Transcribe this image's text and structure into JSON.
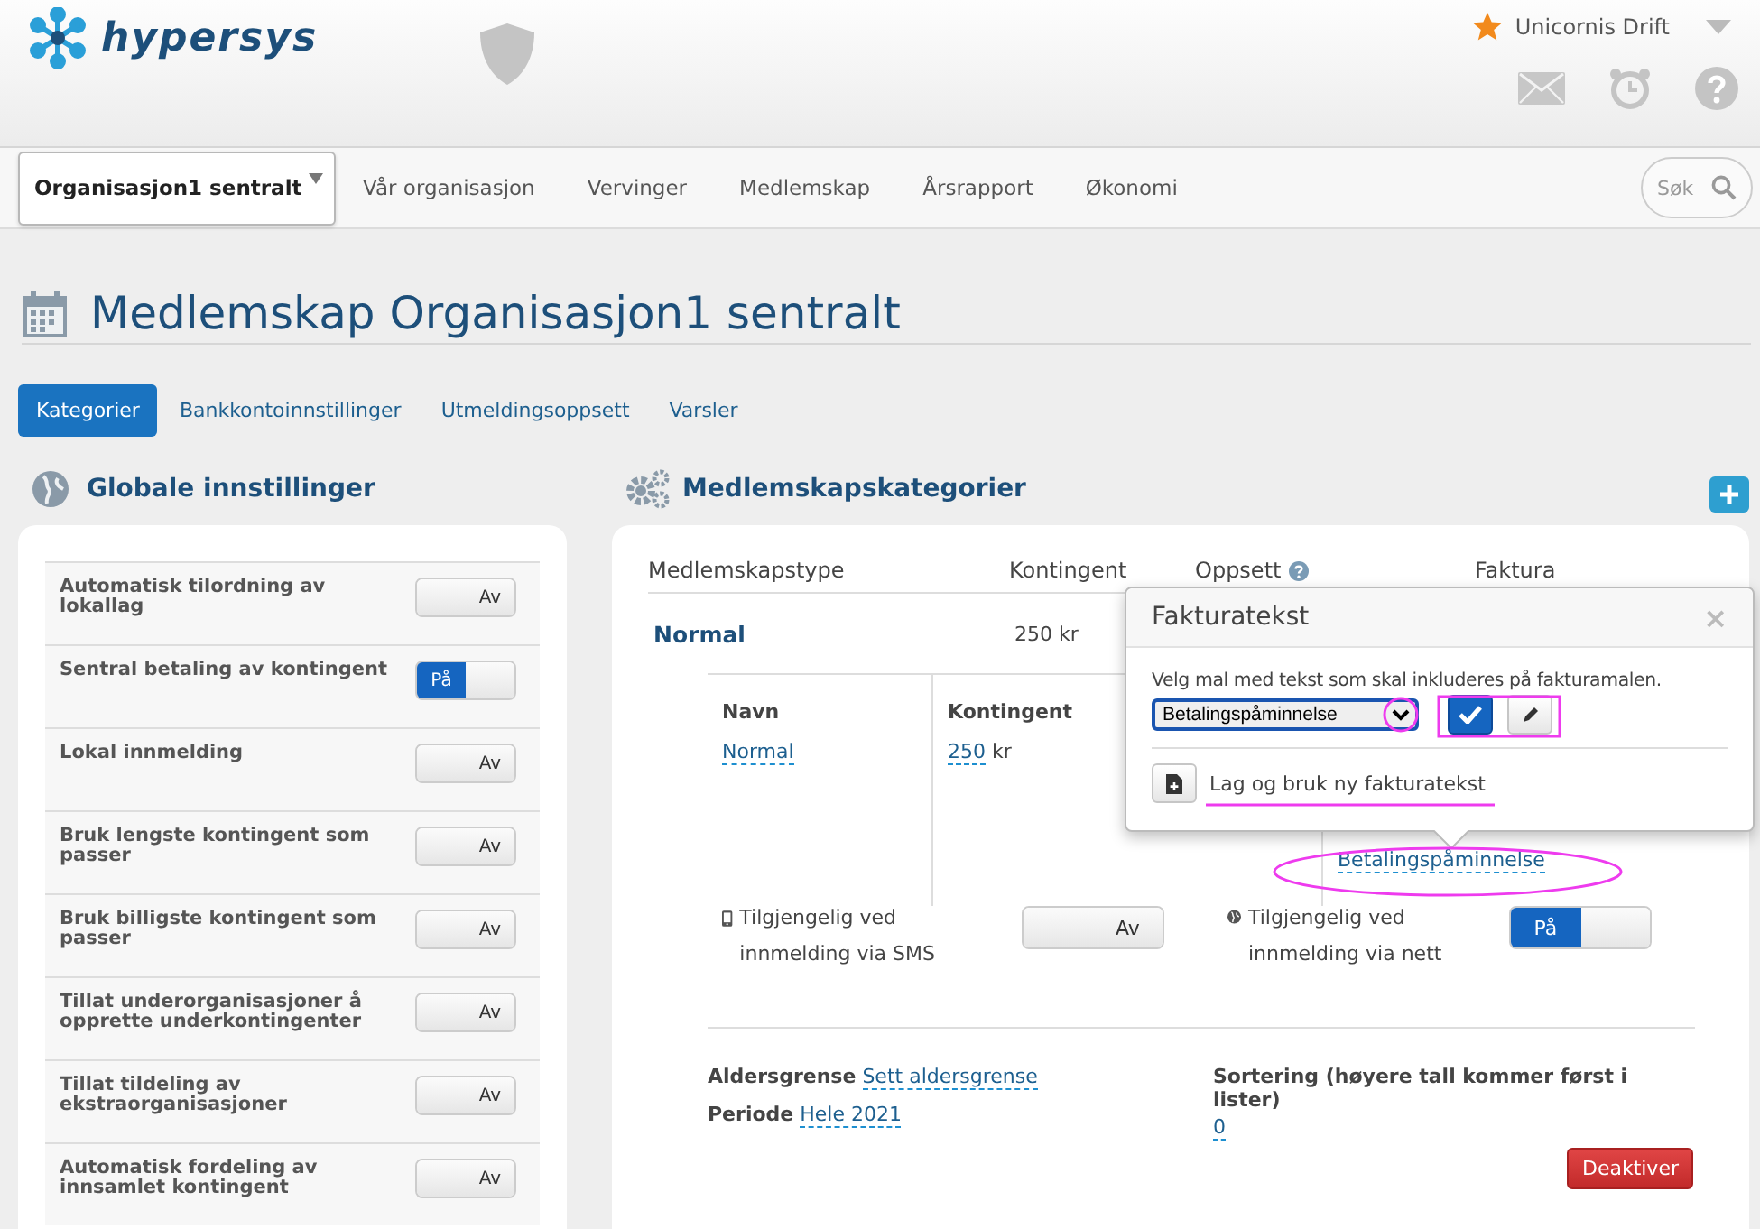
{
  "header": {
    "logo": "hypersys",
    "user": "Unicornis Drift"
  },
  "nav": {
    "org_select": "Organisasjon1 sentralt",
    "links": [
      "Vår organisasjon",
      "Vervinger",
      "Medlemskap",
      "Årsrapport",
      "Økonomi"
    ],
    "search": {
      "placeholder": "Søk"
    }
  },
  "page_title": "Medlemskap Organisasjon1 sentralt",
  "tabs": [
    {
      "label": "Kategorier",
      "selected": true
    },
    {
      "label": "Bankkontoinnstillinger",
      "selected": false
    },
    {
      "label": "Utmeldingsoppsett",
      "selected": false
    },
    {
      "label": "Varsler",
      "selected": false
    }
  ],
  "global_settings": {
    "title": "Globale innstillinger",
    "items": [
      {
        "label": "Automatisk tilordning av lokallag",
        "on": false,
        "toggle_text": "Av"
      },
      {
        "label": "Sentral betaling av kontingent",
        "on": true,
        "toggle_text": "På"
      },
      {
        "label": "Lokal innmelding",
        "on": false,
        "toggle_text": "Av"
      },
      {
        "label": "Bruk lengste kontingent som passer",
        "on": false,
        "toggle_text": "Av"
      },
      {
        "label": "Bruk billigste kontingent som passer",
        "on": false,
        "toggle_text": "Av"
      },
      {
        "label": "Tillat underorganisasjoner å opprette underkontingenter",
        "on": false,
        "toggle_text": "Av"
      },
      {
        "label": "Tillat tildeling av ekstraorganisasjoner",
        "on": false,
        "toggle_text": "Av"
      },
      {
        "label": "Automatisk fordeling av innsamlet kontingent",
        "on": false,
        "toggle_text": "Av"
      }
    ]
  },
  "categories": {
    "title": "Medlemskapskategorier",
    "columns": [
      "Medlemskapstype",
      "Kontingent",
      "Oppsett",
      "Faktura"
    ],
    "row": {
      "type": "Normal",
      "fee": "250 kr",
      "details": {
        "name_label": "Navn",
        "name": "Normal",
        "fee_label": "Kontingent",
        "fee_value": "250",
        "fee_unit": "kr",
        "invoice_text": "Betalingspåminnelse"
      },
      "availability": [
        {
          "kind": "sms",
          "label": "Tilgjengelig ved innmelding via SMS",
          "on": false,
          "toggle_text": "Av"
        },
        {
          "kind": "web",
          "label": "Tilgjengelig ved innmelding via nett",
          "on": true,
          "toggle_text": "På"
        }
      ],
      "age_label": "Aldersgrense",
      "age_value": "Sett aldersgrense",
      "period_label": "Periode",
      "period_value": "Hele 2021",
      "sort_label": "Sortering (høyere tall kommer først i lister)",
      "sort_value": "0",
      "deactivate": "Deaktiver"
    }
  },
  "popover": {
    "title": "Fakturatekst",
    "close": "×",
    "prompt": "Velg mal med tekst som skal inkluderes på fakturamalen.",
    "selected_template": "Betalingspåminnelse",
    "new_link": "Lag og bruk ny fakturatekst"
  }
}
